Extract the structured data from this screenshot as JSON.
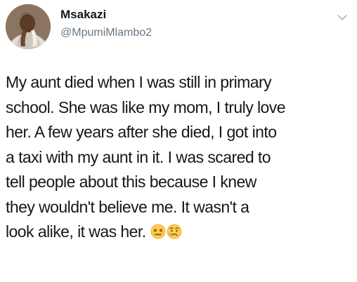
{
  "user": {
    "display_name": "Msakazi",
    "handle": "@MpumiMlambo2"
  },
  "tweet": {
    "lines": [
      "My aunt died when I was still in primary",
      "school. She was like my mom, I truly love",
      "her. A few years after she died, I got into",
      "a taxi with my aunt in it. I was scared to",
      "tell people about this because I knew",
      "they wouldn't believe me. It wasn't a",
      "look alike, it was her."
    ],
    "emojis": [
      "confounded-face-emoji",
      "sad-but-relieved-face-emoji"
    ]
  },
  "colors": {
    "text": "#14171a",
    "secondary_text": "#657786",
    "caret": "#aab8c2"
  },
  "icons": {
    "menu": "chevron-down-icon"
  }
}
